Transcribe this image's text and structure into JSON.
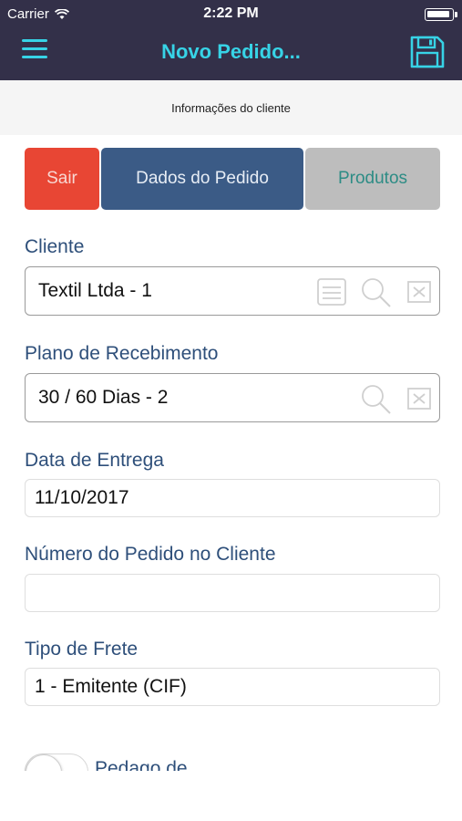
{
  "status_bar": {
    "carrier": "Carrier",
    "time": "2:22 PM"
  },
  "nav": {
    "title": "Novo Pedido...",
    "accent_color": "#37d3e6",
    "background_color": "#333049"
  },
  "section": {
    "title": "Informações do cliente"
  },
  "tabs": {
    "sair": "Sair",
    "dados": "Dados do Pedido",
    "produtos": "Produtos"
  },
  "fields": {
    "cliente": {
      "label": "Cliente",
      "value": "Textil Ltda - 1"
    },
    "plano": {
      "label": "Plano de Recebimento",
      "value": "30 / 60 Dias - 2"
    },
    "data_entrega": {
      "label": "Data de Entrega",
      "value": "11/10/2017"
    },
    "numero_pedido": {
      "label": "Número do Pedido no Cliente",
      "value": ""
    },
    "tipo_frete": {
      "label": "Tipo de Frete",
      "value": "1 - Emitente (CIF)"
    }
  },
  "toggle": {
    "label": "Pedago de ..."
  }
}
